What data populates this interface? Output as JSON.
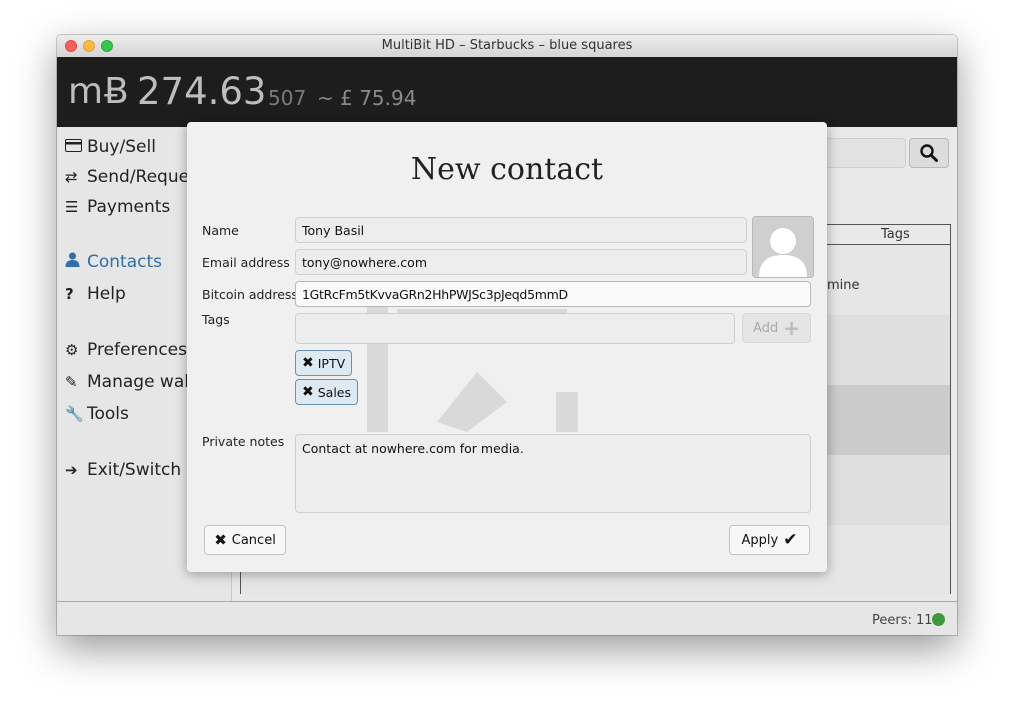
{
  "window": {
    "title": "MultiBit HD – Starbucks – blue squares"
  },
  "balance": {
    "symbol": "mɃ",
    "amount": "274.63",
    "sub_amount": "507",
    "fiat": "~ £ 75.94"
  },
  "sidebar": {
    "items": [
      {
        "label": "Buy/Sell",
        "icon": "credit-card-icon"
      },
      {
        "label": "Send/Reque",
        "icon": "exchange-arrows-icon"
      },
      {
        "label": "Payments",
        "icon": "list-icon"
      },
      {
        "label": "Contacts",
        "icon": "user-icon",
        "active": true
      },
      {
        "label": "Help",
        "icon": "question-icon"
      },
      {
        "label": "Preferences",
        "icon": "gears-icon"
      },
      {
        "label": "Manage wall",
        "icon": "edit-icon"
      },
      {
        "label": "Tools",
        "icon": "wrench-icon"
      },
      {
        "label": "Exit/Switch",
        "icon": "sign-out-icon"
      }
    ]
  },
  "contacts_table": {
    "tags_header": "Tags",
    "row_tags": "mine"
  },
  "status": {
    "peers": "Peers: 11",
    "peer_color": "#3f9a3f"
  },
  "dialog": {
    "title": "New contact",
    "name_label": "Name",
    "name_value": "Tony Basil",
    "email_label": "Email address",
    "email_value": "tony@nowhere.com",
    "bitcoin_label": "Bitcoin address",
    "bitcoin_value": "1GtRcFm5tKvvaGRn2HhPWJSc3pJeqd5mmD",
    "tags_label": "Tags",
    "tags_input_value": "",
    "add_label": "Add",
    "tags": [
      "IPTV",
      "Sales"
    ],
    "notes_label": "Private notes",
    "notes_value": "Contact at nowhere.com for media.",
    "cancel_label": "Cancel",
    "apply_label": "Apply"
  },
  "colors": {
    "accent": "#2f6ea8",
    "header_bg": "#1d1d1d",
    "chip_bg": "#dde9f3"
  }
}
